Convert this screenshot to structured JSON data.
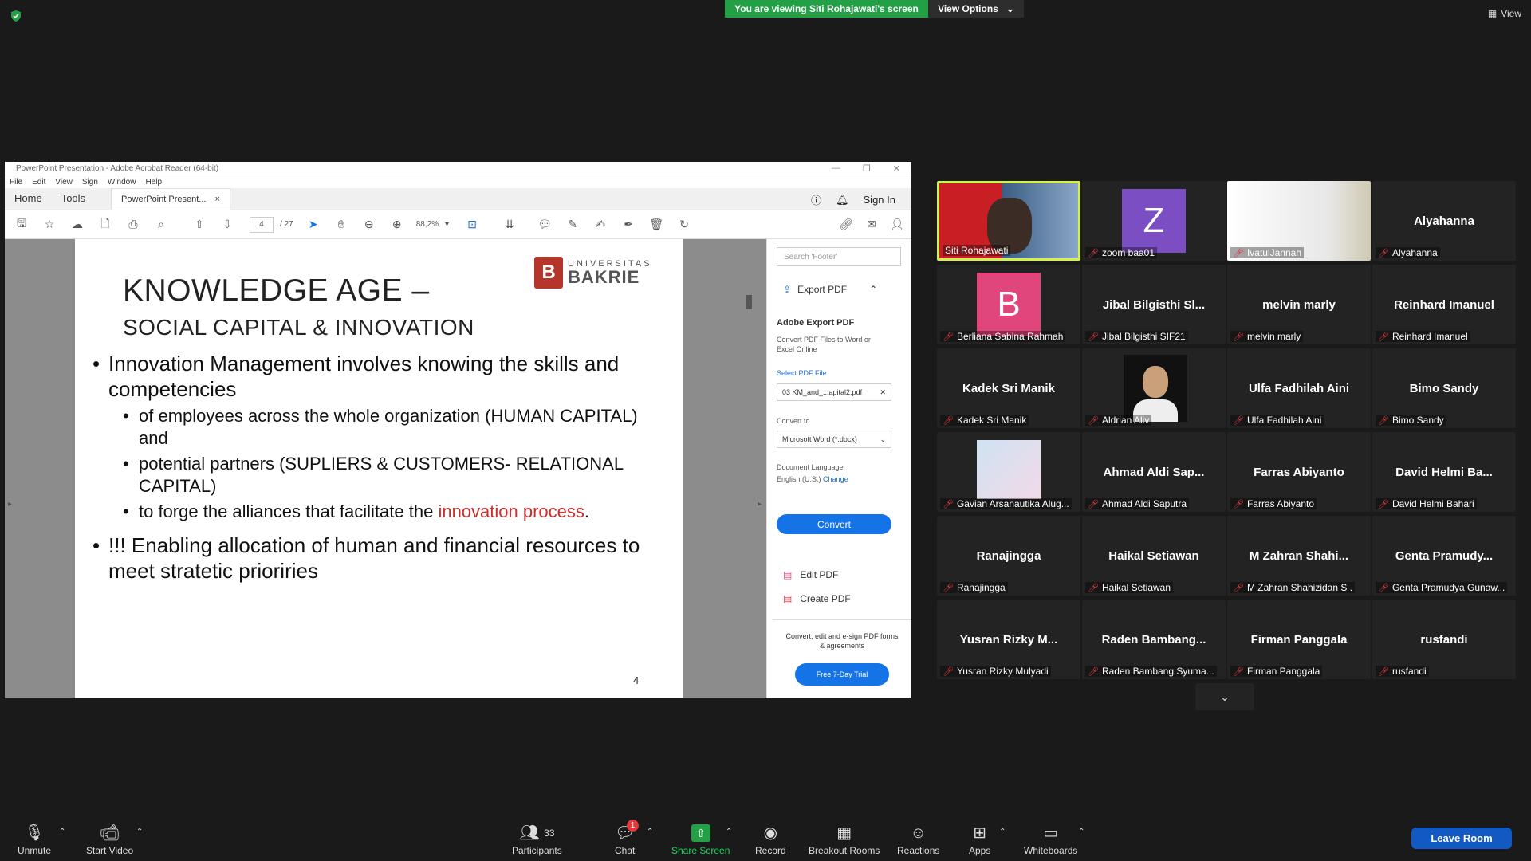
{
  "top": {
    "banner": "You are viewing Siti Rohajawati's screen",
    "view_options": "View Options",
    "view": "View"
  },
  "acrobat": {
    "title": "PowerPoint Presentation - Adobe Acrobat Reader (64-bit)",
    "menu": [
      "File",
      "Edit",
      "View",
      "Sign",
      "Window",
      "Help"
    ],
    "tabs": {
      "home": "Home",
      "tools": "Tools",
      "doc": "PowerPoint Present..."
    },
    "sign_in": "Sign In",
    "page_current": "4",
    "page_total": "/ 27",
    "zoom": "88,2%",
    "slide": {
      "title": "KNOWLEDGE AGE –",
      "subtitle": "SOCIAL CAPITAL & INNOVATION",
      "logo_small": "UNIVERSITAS",
      "logo_big": "BAKRIE",
      "logo_mark": "B",
      "b1": "Innovation Management involves knowing the skills and competencies",
      "b1_1": "of employees across the whole organization (HUMAN CAPITAL) and",
      "b1_2": "potential partners (SUPLIERS & CUSTOMERS- RELATIONAL CAPITAL)",
      "b1_3a": "to forge the alliances that facilitate the ",
      "b1_3b": "innovation process",
      "b1_3c": ".",
      "b2": "!!! Enabling allocation  of human and financial resources to meet stratetic prioriries",
      "page": "4"
    },
    "panel": {
      "search_placeholder": "Search 'Footer'",
      "export": "Export PDF",
      "heading": "Adobe Export PDF",
      "desc": "Convert PDF Files to Word or Excel Online",
      "select": "Select PDF File",
      "file": "03 KM_and_...apital2.pdf",
      "convert_to": "Convert to",
      "format": "Microsoft Word (*.docx)",
      "doc_lang": "Document Language:",
      "lang": "English (U.S.)",
      "change": "Change",
      "convert": "Convert",
      "edit": "Edit PDF",
      "create": "Create PDF",
      "foot": "Convert, edit and e-sign PDF forms & agreements",
      "trial": "Free 7-Day Trial"
    }
  },
  "participants": [
    {
      "big": "",
      "label": "Siti Rohajawati",
      "type": "video",
      "muted": false
    },
    {
      "big": "Z",
      "label": "zoom baa01",
      "type": "avatar",
      "color": "#7b4ec4",
      "muted": true
    },
    {
      "big": "",
      "label": "IvatulJannah",
      "type": "photo",
      "muted": true
    },
    {
      "big": "Alyahanna",
      "label": "Alyahanna",
      "type": "name",
      "muted": true
    },
    {
      "big": "B",
      "label": "Berliana Sabina Rahmah",
      "type": "avatar",
      "color": "#e0457b",
      "muted": true
    },
    {
      "big": "Jibal  Bilgisthi  Sl...",
      "label": "Jibal Bilgisthi SIF21",
      "type": "name",
      "muted": true
    },
    {
      "big": "melvin marly",
      "label": "melvin marly",
      "type": "name",
      "muted": true
    },
    {
      "big": "Reinhard Imanuel",
      "label": "Reinhard Imanuel",
      "type": "name",
      "muted": true
    },
    {
      "big": "Kadek Sri Manik",
      "label": "Kadek Sri Manik",
      "type": "name",
      "muted": true
    },
    {
      "big": "",
      "label": "Aldrian Aliv",
      "type": "photo2",
      "muted": true
    },
    {
      "big": "Ulfa Fadhilah Aini",
      "label": "Ulfa Fadhilah Aini",
      "type": "name",
      "muted": true
    },
    {
      "big": "Bimo Sandy",
      "label": "Bimo Sandy",
      "type": "name",
      "muted": true
    },
    {
      "big": "",
      "label": "Gavian Arsanautika Alug...",
      "type": "photo3",
      "muted": true
    },
    {
      "big": "Ahmad  Aldi  Sap...",
      "label": "Ahmad Aldi Saputra",
      "type": "name",
      "muted": true
    },
    {
      "big": "Farras Abiyanto",
      "label": "Farras Abiyanto",
      "type": "name",
      "muted": true
    },
    {
      "big": "David  Helmi  Ba...",
      "label": "David Helmi Bahari",
      "type": "name",
      "muted": true
    },
    {
      "big": "Ranajingga",
      "label": "Ranajingga",
      "type": "name",
      "muted": true
    },
    {
      "big": "Haikal Setiawan",
      "label": "Haikal Setiawan",
      "type": "name",
      "muted": true
    },
    {
      "big": "M  Zahran  Shahi...",
      "label": "M Zahran Shahizidan S .",
      "type": "name",
      "muted": true
    },
    {
      "big": "Genta  Pramudy...",
      "label": "Genta Pramudya Gunaw...",
      "type": "name",
      "muted": true
    },
    {
      "big": "Yusran  Rizky  M...",
      "label": "Yusran Rizky Mulyadi",
      "type": "name",
      "muted": true
    },
    {
      "big": "Raden  Bambang...",
      "label": "Raden Bambang Syuma...",
      "type": "name",
      "muted": true
    },
    {
      "big": "Firman Panggala",
      "label": "Firman Panggala",
      "type": "name",
      "muted": true
    },
    {
      "big": "rusfandi",
      "label": "rusfandi",
      "type": "name",
      "muted": true
    }
  ],
  "bottom": {
    "unmute": "Unmute",
    "start_video": "Start Video",
    "participants": "Participants",
    "participants_count": "33",
    "chat": "Chat",
    "chat_badge": "1",
    "share": "Share Screen",
    "record": "Record",
    "breakout": "Breakout Rooms",
    "reactions": "Reactions",
    "apps": "Apps",
    "whiteboards": "Whiteboards",
    "leave": "Leave Room"
  },
  "colors": {
    "share_green": "#23a046",
    "leave_blue": "#1259c3",
    "active_border": "#d5f047",
    "muted_red": "#e0383b"
  }
}
